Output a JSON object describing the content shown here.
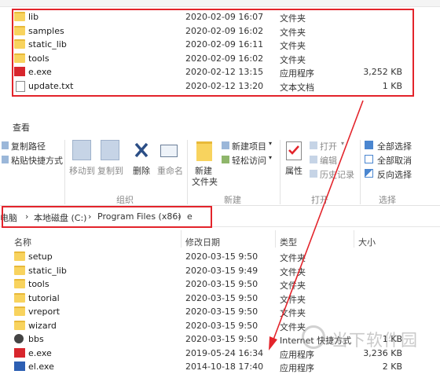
{
  "top_list": [
    {
      "name": "lib",
      "date": "2020-02-09 16:07",
      "type": "文件夹",
      "size": "",
      "icon": "folder-icon"
    },
    {
      "name": "samples",
      "date": "2020-02-09 16:02",
      "type": "文件夹",
      "size": "",
      "icon": "folder-icon"
    },
    {
      "name": "static_lib",
      "date": "2020-02-09 16:11",
      "type": "文件夹",
      "size": "",
      "icon": "folder-icon"
    },
    {
      "name": "tools",
      "date": "2020-02-09 16:02",
      "type": "文件夹",
      "size": "",
      "icon": "folder-icon"
    },
    {
      "name": "e.exe",
      "date": "2020-02-12 13:15",
      "type": "应用程序",
      "size": "3,252 KB",
      "icon": "exe-icon"
    },
    {
      "name": "update.txt",
      "date": "2020-02-12 13:20",
      "type": "文本文档",
      "size": "1 KB",
      "icon": "text-file-icon"
    }
  ],
  "ribbon": {
    "tab": "查看",
    "copy_path": "复制路径",
    "paste_shortcut": "粘贴快捷方式",
    "move_to": "移动到",
    "copy_to": "复制到",
    "delete": "删除",
    "rename": "重命名",
    "group_organize": "组织",
    "new_folder": "新建\n文件夹",
    "new_folder_l1": "新建",
    "new_folder_l2": "文件夹",
    "new_item": "新建项目",
    "easy_access": "轻松访问",
    "group_new": "新建",
    "properties": "属性",
    "open": "打开",
    "edit": "编辑",
    "history": "历史记录",
    "group_open": "打开",
    "select_all": "全部选择",
    "select_none": "全部取消",
    "invert_select": "反向选择",
    "group_select": "选择"
  },
  "breadcrumb": [
    "电脑",
    "本地磁盘 (C:)",
    "Program Files (x86)",
    "e"
  ],
  "columns": {
    "name": "名称",
    "date": "修改日期",
    "type": "类型",
    "size": "大小"
  },
  "bottom_list": [
    {
      "name": "setup",
      "date": "2020-03-15 9:50",
      "type": "文件夹",
      "size": "",
      "icon": "folder-icon"
    },
    {
      "name": "static_lib",
      "date": "2020-03-15 9:49",
      "type": "文件夹",
      "size": "",
      "icon": "folder-icon"
    },
    {
      "name": "tools",
      "date": "2020-03-15 9:50",
      "type": "文件夹",
      "size": "",
      "icon": "folder-icon"
    },
    {
      "name": "tutorial",
      "date": "2020-03-15 9:50",
      "type": "文件夹",
      "size": "",
      "icon": "folder-icon"
    },
    {
      "name": "vreport",
      "date": "2020-03-15 9:50",
      "type": "文件夹",
      "size": "",
      "icon": "folder-icon"
    },
    {
      "name": "wizard",
      "date": "2020-03-15 9:50",
      "type": "文件夹",
      "size": "",
      "icon": "folder-icon"
    },
    {
      "name": "bbs",
      "date": "2020-03-15 9:50",
      "type": "Internet 快捷方式",
      "size": "1 KB",
      "icon": "bbs-icon"
    },
    {
      "name": "e.exe",
      "date": "2019-05-24 16:34",
      "type": "应用程序",
      "size": "3,236 KB",
      "icon": "exe-icon"
    },
    {
      "name": "el.exe",
      "date": "2014-10-18 17:40",
      "type": "应用程序",
      "size": "2 KB",
      "icon": "app-icon"
    }
  ],
  "watermark": "当下软件园",
  "colors": {
    "highlight": "#e3242b",
    "folder": "#f8d35e",
    "arrow": "#e3242b"
  }
}
